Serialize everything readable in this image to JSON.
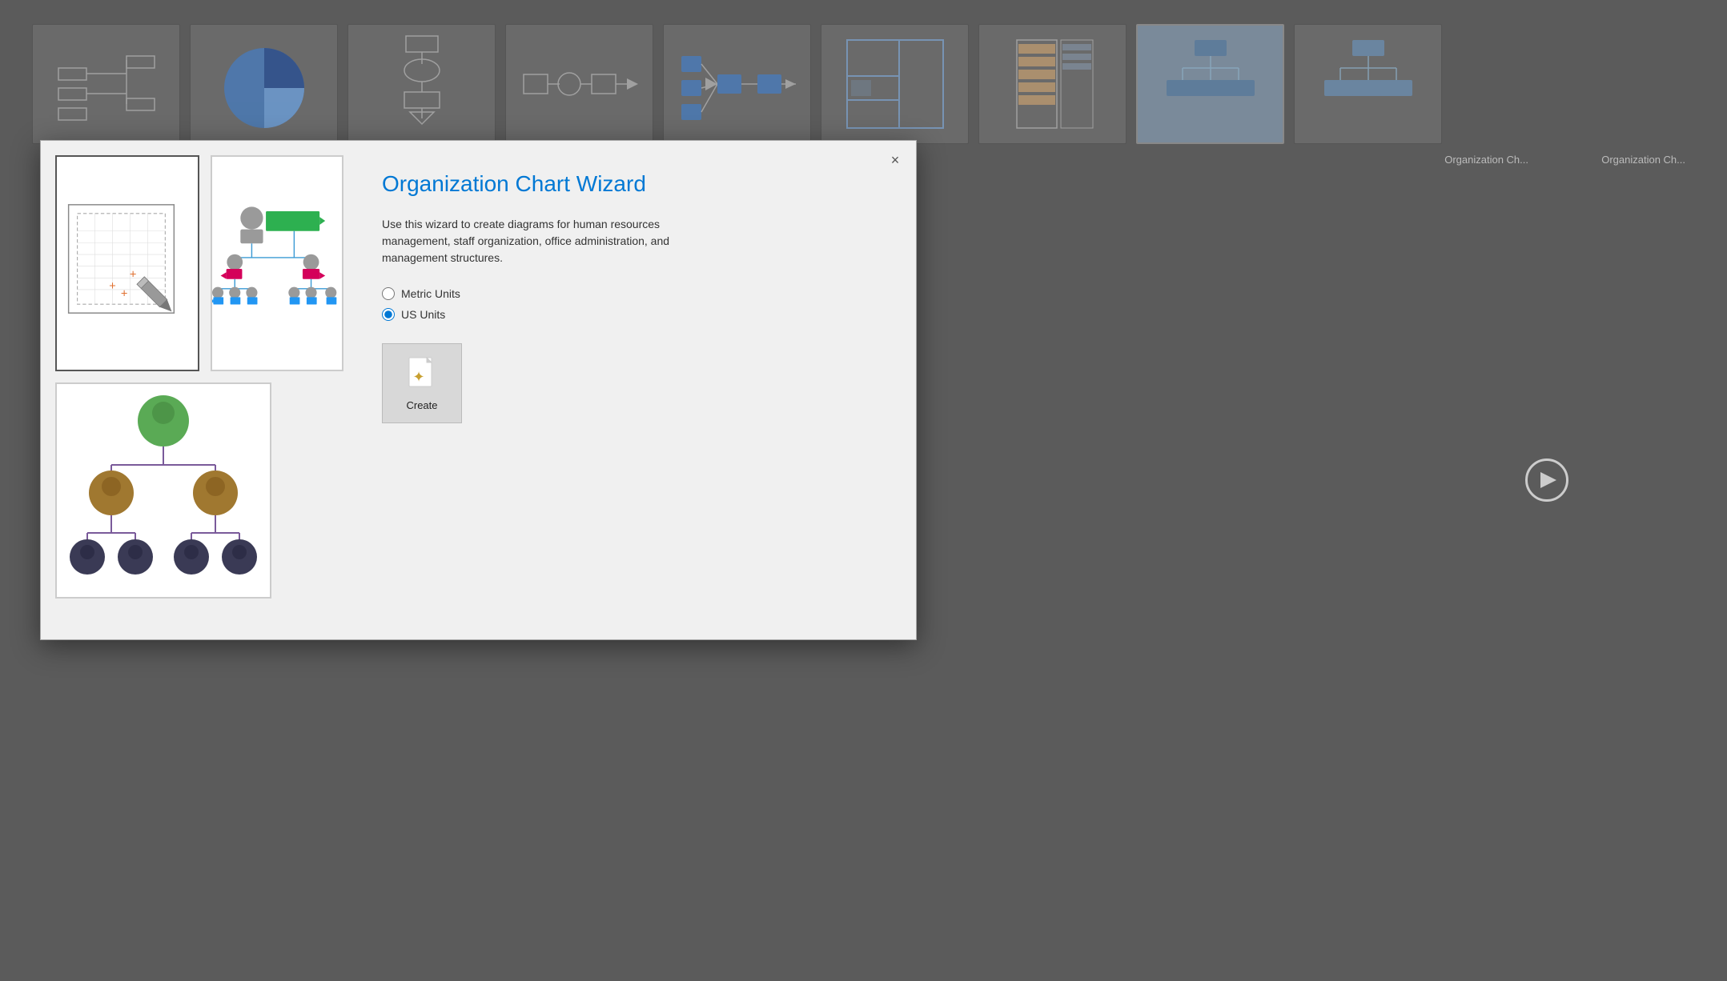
{
  "background": {
    "thumbnails": [
      {
        "name": "network-diagram",
        "label": ""
      },
      {
        "name": "pie-chart",
        "label": ""
      },
      {
        "name": "flowchart-vertical",
        "label": ""
      },
      {
        "name": "flowchart-horizontal",
        "label": ""
      },
      {
        "name": "data-flow",
        "label": ""
      },
      {
        "name": "floor-plan",
        "label": ""
      },
      {
        "name": "network-rack",
        "label": ""
      },
      {
        "name": "org-chart-bg",
        "label": "Organization Ch..."
      },
      {
        "name": "org-chart-bg2",
        "label": "Organization Ch..."
      }
    ]
  },
  "dialog": {
    "title": "Organization Chart Wizard",
    "description": "Use this wizard to create diagrams for human resources management, staff organization, office administration, and management structures.",
    "close_label": "×",
    "units": {
      "metric_label": "Metric Units",
      "us_label": "US Units",
      "selected": "us"
    },
    "create_button_label": "Create"
  }
}
